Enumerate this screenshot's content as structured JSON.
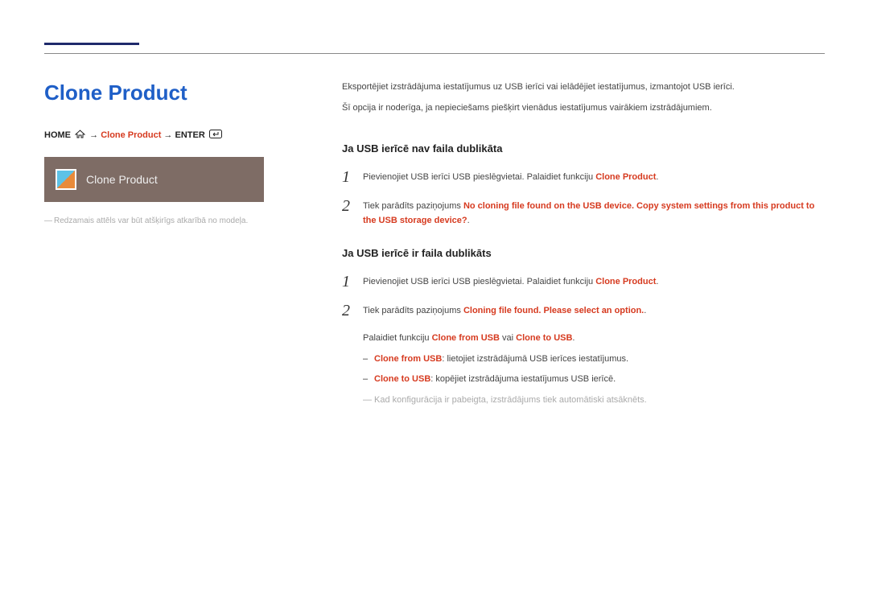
{
  "title": "Clone Product",
  "breadcrumb": {
    "p1": "HOME",
    "arrow": "→",
    "p2": "Clone Product",
    "p3": "ENTER"
  },
  "menu": {
    "label": "Clone Product"
  },
  "left_note": "Redzamais attēls var būt atšķirīgs atkarībā no modeļa.",
  "intro": {
    "line1": "Eksportējiet izstrādājuma iestatījumus uz USB ierīci vai ielādējiet iestatījumus, izmantojot USB ierīci.",
    "line2": "Šī opcija ir noderīga, ja nepieciešams piešķirt vienādus iestatījumus vairākiem izstrādājumiem."
  },
  "sec1": {
    "head": "Ja USB ierīcē nav faila dublikāta",
    "s1_a": "Pievienojiet USB ierīci USB pieslēgvietai. Palaidiet funkciju ",
    "s1_b": "Clone Product",
    "s1_c": ".",
    "s2_a": "Tiek parādīts paziņojums ",
    "s2_b": "No cloning file found on the USB device. Copy system settings from this product to the USB storage device?",
    "s2_c": "."
  },
  "sec2": {
    "head": "Ja USB ierīcē ir faila dublikāts",
    "s1_a": "Pievienojiet USB ierīci USB pieslēgvietai. Palaidiet funkciju ",
    "s1_b": "Clone Product",
    "s1_c": ".",
    "s2_a": "Tiek parādīts paziņojums ",
    "s2_b": "Cloning file found. Please select an option.",
    "s2_c": ".",
    "run_a": "Palaidiet funkciju ",
    "run_b": "Clone from USB",
    "run_c": " vai ",
    "run_d": "Clone to USB",
    "run_e": ".",
    "d1_a": "Clone from USB",
    "d1_b": ": lietojiet izstrādājumā USB ierīces iestatījumus.",
    "d2_a": "Clone to USB",
    "d2_b": ": kopējiet izstrādājuma iestatījumus USB ierīcē.",
    "final": "Kad konfigurācija ir pabeigta, izstrādājums tiek automātiski atsāknēts."
  },
  "nums": {
    "n1": "1",
    "n2": "2"
  }
}
